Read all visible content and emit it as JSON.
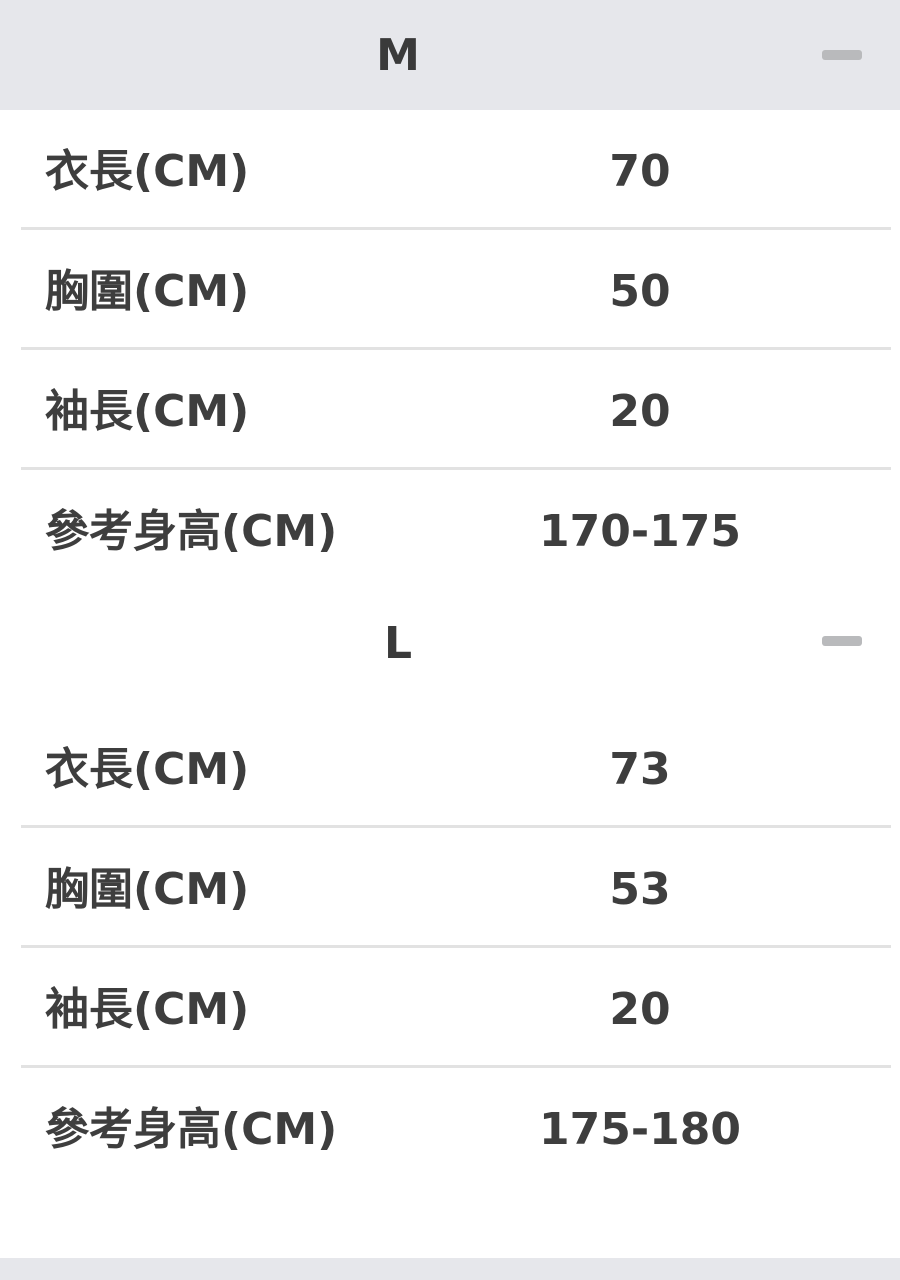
{
  "sections": [
    {
      "title": "M",
      "collapse_icon": "minus-icon",
      "rows": [
        {
          "label": "衣長(CM)",
          "value": "70"
        },
        {
          "label": "胸圍(CM)",
          "value": "50"
        },
        {
          "label": "袖長(CM)",
          "value": "20"
        },
        {
          "label": "參考身高(CM)",
          "value": "170-175"
        }
      ]
    },
    {
      "title": "L",
      "collapse_icon": "minus-icon",
      "rows": [
        {
          "label": "衣長(CM)",
          "value": "73"
        },
        {
          "label": "胸圍(CM)",
          "value": "53"
        },
        {
          "label": "袖長(CM)",
          "value": "20"
        },
        {
          "label": "參考身高(CM)",
          "value": "175-180"
        }
      ]
    }
  ],
  "colors": {
    "header_bg": "#e6e7eb",
    "text": "#3e3e3e",
    "divider": "#e2e2e2",
    "icon": "#b9babc"
  }
}
